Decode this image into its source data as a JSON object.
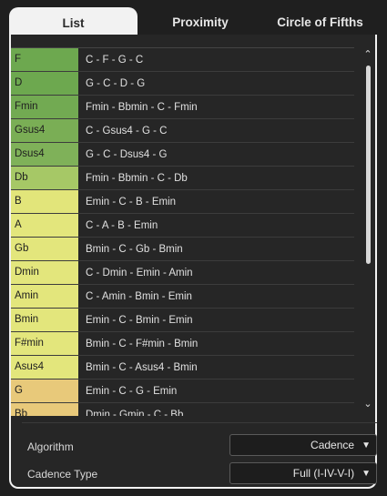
{
  "tabs": [
    {
      "label": "List",
      "active": true
    },
    {
      "label": "Proximity",
      "active": false
    },
    {
      "label": "Circle of Fifths",
      "active": false
    }
  ],
  "list": {
    "rows": [
      {
        "chord": "F",
        "progression": "C - F - G - C",
        "color": "#6da84f"
      },
      {
        "chord": "D",
        "progression": "G - C - D - G",
        "color": "#6da84f"
      },
      {
        "chord": "Fmin",
        "progression": "Fmin - Bbmin - C - Fmin",
        "color": "#72aa52"
      },
      {
        "chord": "Gsus4",
        "progression": "C - Gsus4 - G - C",
        "color": "#7aae55"
      },
      {
        "chord": "Dsus4",
        "progression": "G - C - Dsus4 - G",
        "color": "#7fb159"
      },
      {
        "chord": "Db",
        "progression": "Fmin - Bbmin - C - Db",
        "color": "#a6c866"
      },
      {
        "chord": "B",
        "progression": "Emin - C - B - Emin",
        "color": "#e2e57a"
      },
      {
        "chord": "A",
        "progression": "C - A - B - Emin",
        "color": "#e3e67c"
      },
      {
        "chord": "Gb",
        "progression": "Bmin - C - Gb - Bmin",
        "color": "#e3e67c"
      },
      {
        "chord": "Dmin",
        "progression": "C - Dmin - Emin - Amin",
        "color": "#e3e67c"
      },
      {
        "chord": "Amin",
        "progression": "C - Amin - Bmin - Emin",
        "color": "#e3e67c"
      },
      {
        "chord": "Bmin",
        "progression": "Emin - C - Bmin - Emin",
        "color": "#e3e67c"
      },
      {
        "chord": "F#min",
        "progression": "Bmin - C - F#min - Bmin",
        "color": "#e3e67c"
      },
      {
        "chord": "Asus4",
        "progression": "Bmin - C - Asus4 - Bmin",
        "color": "#e3e67c"
      },
      {
        "chord": "G",
        "progression": "Emin - C - G - Emin",
        "color": "#e8c97a"
      },
      {
        "chord": "Bb",
        "progression": "Dmin - Gmin - C - Bb",
        "color": "#e8c97a"
      }
    ]
  },
  "algorithm": {
    "label": "Algorithm",
    "value": "Cadence"
  },
  "cadence_type": {
    "label": "Cadence Type",
    "value": "Full (I-IV-V-I)"
  }
}
